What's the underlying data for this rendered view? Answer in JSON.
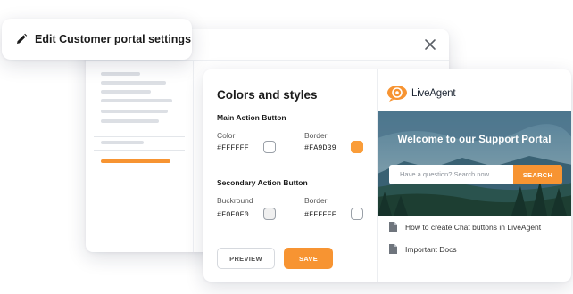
{
  "dialog": {
    "title": "Edit Customer portal settings",
    "icons": {
      "edit": "pencil-icon",
      "close": "close-icon"
    }
  },
  "colors_panel": {
    "heading": "Colors and styles",
    "main_action": {
      "heading": "Main Action Button",
      "color_label": "Color",
      "color_value": "#FFFFFF",
      "border_label": "Border",
      "border_value": "#FA9D39"
    },
    "secondary_action": {
      "heading": "Secondary Action Button",
      "background_label": "Buckround",
      "background_value": "#F0F0F0",
      "border_label": "Border",
      "border_value": "#FFFFFF"
    },
    "preview_label": "PREVIEW",
    "save_label": "SAVE"
  },
  "portal": {
    "logo_text": "LiveAgent",
    "welcome": "Welcome to our Support Portal",
    "search_placeholder": "Have a question? Search now",
    "search_button": "SEARCH",
    "docs": [
      {
        "title": "How to create Chat buttons in LiveAgent"
      },
      {
        "title": "Important Docs"
      }
    ]
  },
  "colors": {
    "accent": "#F79432",
    "accent_border": "#FA9D39",
    "swatch_white": "#FFFFFF",
    "swatch_gray": "#F0F0F0"
  }
}
